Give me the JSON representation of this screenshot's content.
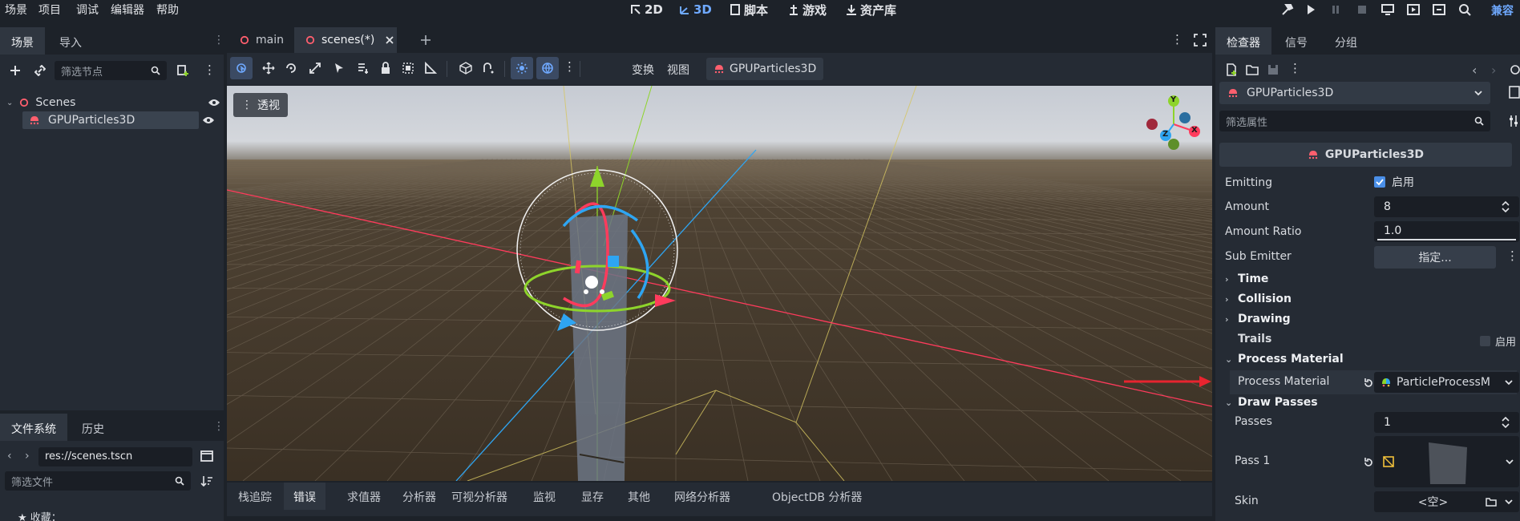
{
  "menu": [
    "场景",
    "项目",
    "调试",
    "编辑器",
    "帮助"
  ],
  "modes": [
    {
      "label": "2D",
      "active": false
    },
    {
      "label": "3D",
      "active": true
    },
    {
      "label": "脚本",
      "active": false
    },
    {
      "label": "游戏",
      "active": false
    },
    {
      "label": "资产库",
      "active": false
    }
  ],
  "compat_label": "兼容",
  "scene_dock": {
    "tabs": [
      "场景",
      "导入"
    ],
    "filter_placeholder": "筛选节点",
    "nodes": [
      {
        "name": "Scenes",
        "icon": "node3d-icon"
      },
      {
        "name": "GPUParticles3D",
        "icon": "gpu-particles-icon",
        "selected": true
      }
    ]
  },
  "file_dock": {
    "tabs": [
      "文件系统",
      "历史"
    ],
    "path": "res://scenes.tscn",
    "filter_placeholder": "筛选文件",
    "favorites_label": "收藏："
  },
  "editor_tabs": [
    {
      "label": "main",
      "active": false
    },
    {
      "label": "scenes(*)",
      "active": true
    }
  ],
  "toolbar": {
    "transform_label": "变换",
    "view_label": "视图",
    "node_label": "GPUParticles3D"
  },
  "viewport": {
    "perspective_label": "透视",
    "gizmo_axes": [
      "Y",
      "X",
      "Z"
    ]
  },
  "bottom_tabs": [
    "栈追踪",
    "错误",
    "求值器",
    "分析器",
    "可视分析器",
    "监视",
    "显存",
    "其他",
    "网络分析器",
    "ObjectDB 分析器"
  ],
  "bottom_active": 1,
  "inspector": {
    "tabs": [
      "检查器",
      "信号",
      "分组"
    ],
    "node_select": "GPUParticles3D",
    "filter_placeholder": "筛选属性",
    "class_header": "GPUParticles3D",
    "props": {
      "emitting_label": "Emitting",
      "emitting_value": "启用",
      "amount_label": "Amount",
      "amount_value": "8",
      "amount_ratio_label": "Amount Ratio",
      "amount_ratio_value": "1.0",
      "amount_ratio_fraction": 1.0,
      "sub_emitter_label": "Sub Emitter",
      "sub_emitter_value": "指定...",
      "trails_label": "Trails",
      "trails_value": "启用",
      "process_material_label": "Process Material",
      "process_material_value": "ParticleProcessM",
      "passes_label": "Passes",
      "passes_value": "1",
      "pass1_label": "Pass 1",
      "skin_label": "Skin",
      "skin_value": "<空>"
    },
    "sections": {
      "time": "Time",
      "collision": "Collision",
      "drawing": "Drawing",
      "process_material": "Process Material",
      "draw_passes": "Draw Passes"
    }
  },
  "colors": {
    "accent": "#6fa9ff",
    "x_axis": "#ff3b5c",
    "y_axis": "#8ed42b",
    "z_axis": "#2ea5f2",
    "annotation_arrow": "#e8242f"
  }
}
